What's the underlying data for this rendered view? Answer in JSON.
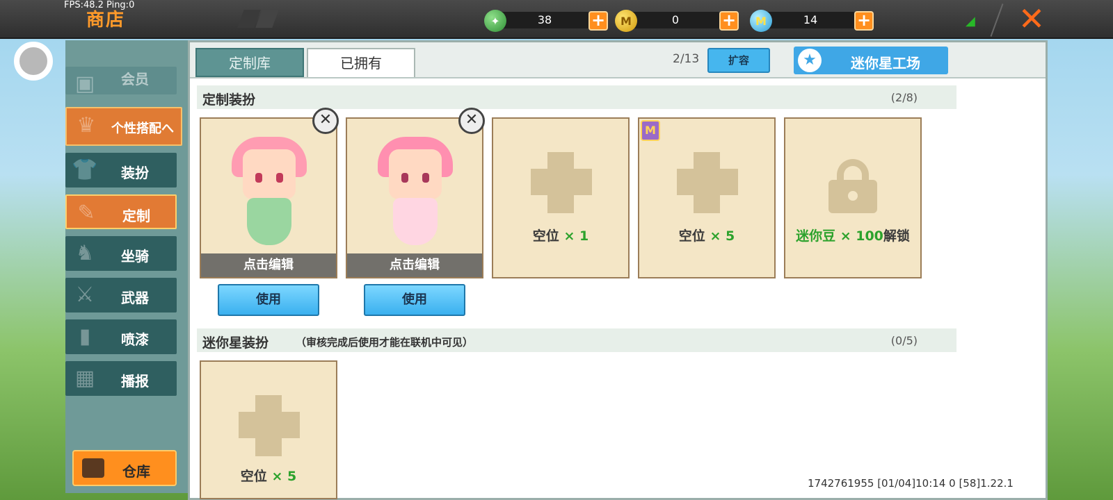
{
  "topbar": {
    "fps": "FPS:48.2  Ping:0",
    "title": "商店",
    "currencies": [
      {
        "name": "gem",
        "icon": "green-gem-icon",
        "value": "38"
      },
      {
        "name": "coin",
        "icon": "gold-coin-icon",
        "value": "0"
      },
      {
        "name": "star-coin",
        "icon": "blue-star-coin-icon",
        "value": "14"
      }
    ],
    "plus": "+",
    "close": "✕"
  },
  "sidebar": {
    "items": [
      {
        "label": "会员",
        "state": "faded"
      },
      {
        "label": "个性搭配へ",
        "state": "expanded"
      },
      {
        "label": "装扮",
        "state": "normal"
      },
      {
        "label": "定制",
        "state": "active"
      },
      {
        "label": "坐骑",
        "state": "normal"
      },
      {
        "label": "武器",
        "state": "normal"
      },
      {
        "label": "喷漆",
        "state": "normal"
      },
      {
        "label": "播报",
        "state": "normal"
      }
    ],
    "warehouse": "仓库"
  },
  "panel": {
    "tabs": [
      "定制库",
      "已拥有"
    ],
    "capacity": "2/13",
    "expand_label": "扩容",
    "mini_factory_label": "迷你星工场"
  },
  "custom_section": {
    "title": "定制装扮",
    "count": "(2/8)",
    "cards": [
      {
        "type": "outfit",
        "edit_label": "点击编辑",
        "use_label": "使用"
      },
      {
        "type": "outfit",
        "edit_label": "点击编辑",
        "use_label": "使用"
      },
      {
        "type": "empty",
        "slot_label": "空位",
        "slot_count": "× 1"
      },
      {
        "type": "empty",
        "slot_label": "空位",
        "slot_count": "× 5",
        "badge": "M"
      },
      {
        "type": "locked",
        "unlock_prefix": "迷你豆 × 100",
        "unlock_suffix": "解锁"
      }
    ]
  },
  "mini_section": {
    "title": "迷你星装扮",
    "note": "（审核完成后使用才能在联机中可见）",
    "count": "(0/5)",
    "card": {
      "slot_label": "空位",
      "slot_count": "× 5"
    }
  },
  "footer": "1742761955   [01/04]10:14 0   [58]1.22.1",
  "colors": {
    "accent_orange": "#ff8f1e",
    "active_tab": "#5e9493",
    "card_bg": "#f4e6c6",
    "use_button": "#3ab0ef",
    "green_text": "#2ca22c"
  }
}
